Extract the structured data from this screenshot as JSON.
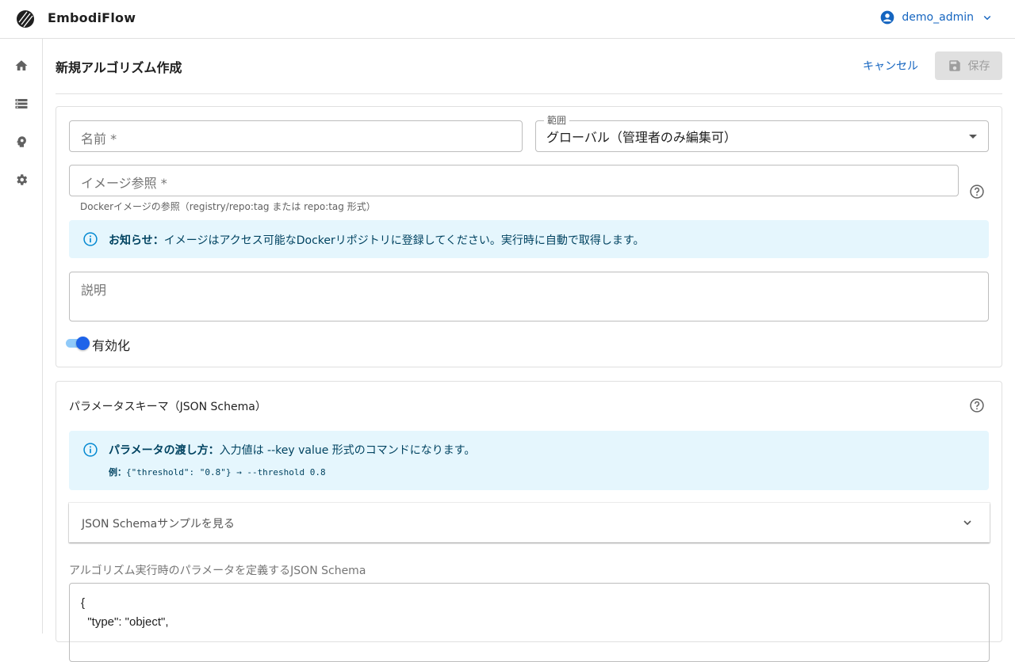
{
  "app": {
    "title": "EmbodiFlow"
  },
  "user": {
    "name": "demo_admin"
  },
  "sidebar": {
    "items": [
      {
        "icon": "home-icon"
      },
      {
        "icon": "list-icon"
      },
      {
        "icon": "brain-icon"
      },
      {
        "icon": "gear-icon"
      }
    ]
  },
  "page": {
    "title": "新規アルゴリズム作成",
    "cancel_label": "キャンセル",
    "save_label": "保存"
  },
  "form": {
    "name_placeholder": "名前 *",
    "scope_label": "範囲",
    "scope_value": "グローバル（管理者のみ編集可）",
    "image_placeholder": "イメージ参照 *",
    "image_helper": "Dockerイメージの参照（registry/repo:tag または repo:tag 形式）",
    "notice_title": "お知らせ：",
    "notice_body": "イメージはアクセス可能なDockerリポジトリに登録してください。実行時に自動で取得します。",
    "description_placeholder": "説明",
    "enabled_label": "有効化",
    "enabled": true
  },
  "schema": {
    "section_title": "パラメータスキーマ（JSON Schema）",
    "info_title": "パラメータの渡し方：",
    "info_body": "入力値は --key value 形式のコマンドになります。",
    "example_label": "例：",
    "example_code": "{\"threshold\": \"0.8\"} → --threshold 0.8",
    "accordion_label": "JSON Schemaサンプルを見る",
    "editor_label": "アルゴリズム実行時のパラメータを定義するJSON Schema",
    "editor_lines": [
      "{",
      "  \"type\": \"object\","
    ]
  },
  "colors": {
    "primary": "#1565c0",
    "info_bg": "#e5f6fd",
    "info_text": "#014361",
    "toggle": "#1e63e9"
  }
}
